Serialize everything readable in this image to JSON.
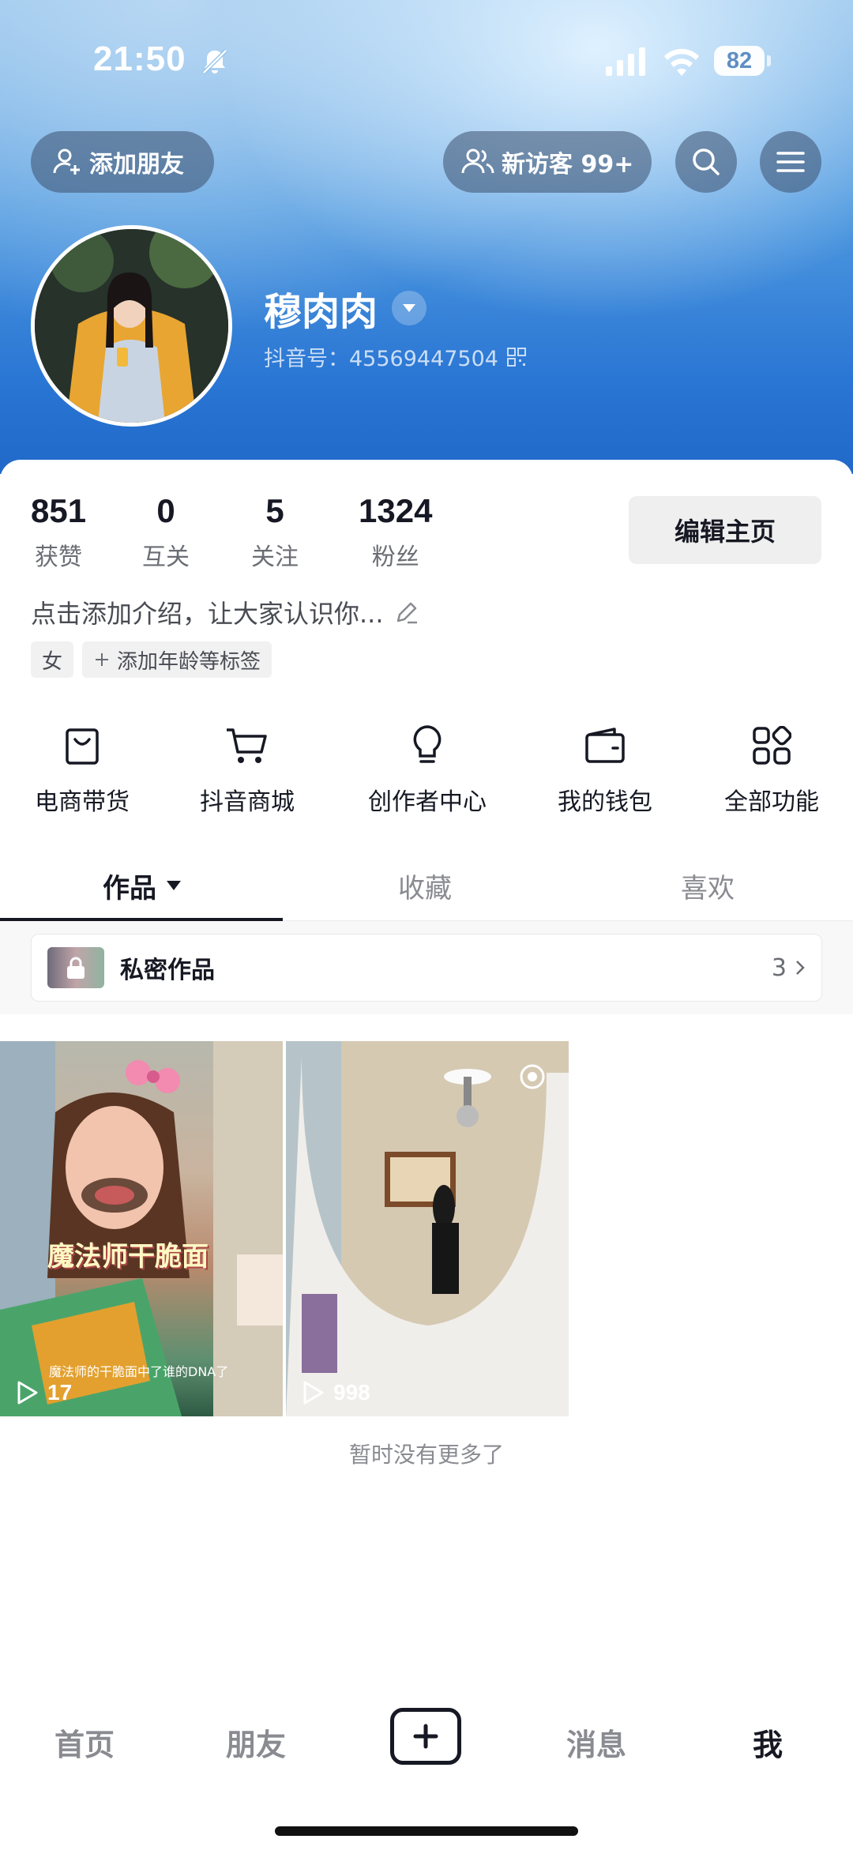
{
  "status_bar": {
    "time": "21:50",
    "battery": "82"
  },
  "top_bar": {
    "add_friend": "添加朋友",
    "visitors": "新访客 99+"
  },
  "profile": {
    "name": "穆肉肉",
    "douyin_id": "抖音号：45569447504"
  },
  "stats": [
    {
      "value": "851",
      "label": "获赞"
    },
    {
      "value": "0",
      "label": "互关"
    },
    {
      "value": "5",
      "label": "关注"
    },
    {
      "value": "1324",
      "label": "粉丝"
    }
  ],
  "edit_profile": "编辑主页",
  "bio_placeholder": "点击添加介绍，让大家认识你...",
  "tags": {
    "gender": "女",
    "add": "添加年龄等标签"
  },
  "functions": [
    {
      "label": "电商带货",
      "icon": "bag-icon"
    },
    {
      "label": "抖音商城",
      "icon": "cart-icon"
    },
    {
      "label": "创作者中心",
      "icon": "bulb-icon"
    },
    {
      "label": "我的钱包",
      "icon": "wallet-icon"
    },
    {
      "label": "全部功能",
      "icon": "grid-icon"
    }
  ],
  "tabs": {
    "works": "作品",
    "favorites": "收藏",
    "likes": "喜欢"
  },
  "private_works": {
    "title": "私密作品",
    "count": "3"
  },
  "videos": [
    {
      "caption": "魔法师干脆面",
      "subtitle": "魔法师的干脆面中了谁的DNA了",
      "plays": "17"
    },
    {
      "plays": "998"
    }
  ],
  "no_more": "暂时没有更多了",
  "bottom_nav": {
    "home": "首页",
    "friends": "朋友",
    "messages": "消息",
    "me": "我"
  }
}
